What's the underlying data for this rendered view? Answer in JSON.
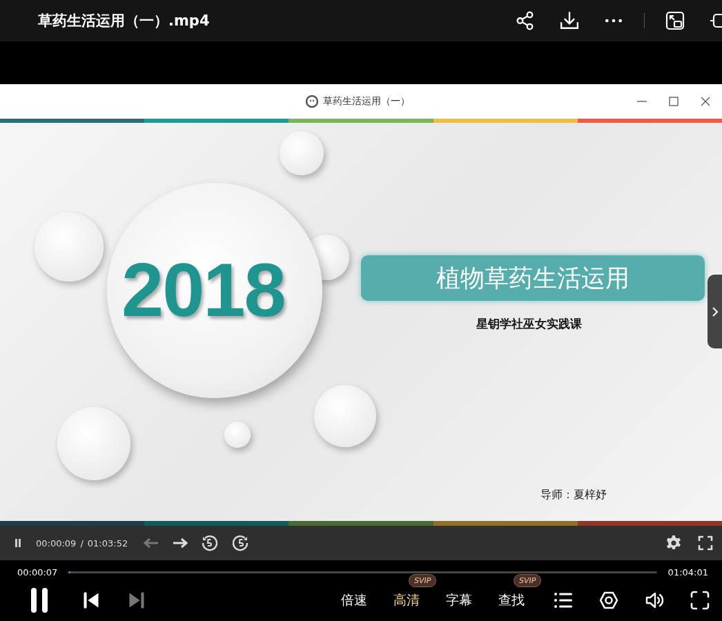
{
  "header": {
    "title": "草药生活运用（一）.mp4"
  },
  "video": {
    "window_title": "草药生活运用（一）",
    "slide": {
      "year": "2018",
      "banner": "植物草药生活运用",
      "subtitle": "星钥学社巫女实践课",
      "instructor": "导师：夏梓妤"
    },
    "inner_controls": {
      "current": "00:00:09",
      "separator": "/",
      "duration": "01:03:52",
      "back_disabled": true
    }
  },
  "progress": {
    "elapsed": "00:00:07",
    "total": "01:04:01",
    "level": 0.003
  },
  "playback": {
    "next_disabled": true
  },
  "options": [
    {
      "label": "倍速",
      "selected": false
    },
    {
      "label": "高清",
      "selected": true,
      "badge": "SVIP"
    },
    {
      "label": "字幕",
      "selected": false
    },
    {
      "label": "查找",
      "selected": false,
      "badge": "SVIP"
    }
  ]
}
